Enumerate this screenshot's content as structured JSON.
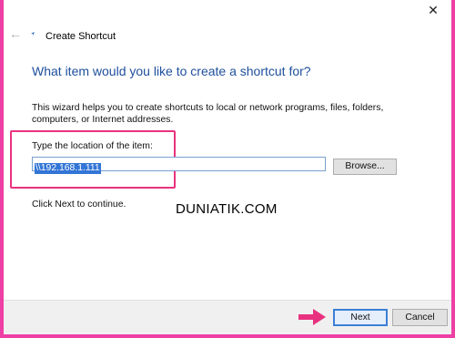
{
  "window": {
    "title": "Create Shortcut",
    "close_glyph": "✕"
  },
  "nav": {
    "back_glyph": "←"
  },
  "main": {
    "heading": "What item would you like to create a shortcut for?",
    "description": "This wizard helps you to create shortcuts to local or network programs, files, folders, computers, or Internet addresses.",
    "location_label": "Type the location of the item:",
    "location_value": "\\\\192.168.1.111",
    "browse_label": "Browse...",
    "continue_hint": "Click Next to continue."
  },
  "watermark": "DUNIATIK.COM",
  "footer": {
    "next_label": "Next",
    "cancel_label": "Cancel"
  },
  "colors": {
    "annotation": "#e8327f",
    "heading": "#1e4f9c",
    "selection": "#3375d6",
    "background": "#ee3fa4"
  },
  "icons": [
    "close-icon",
    "back-arrow-icon",
    "shortcut-app-icon",
    "pointer-arrow-icon"
  ]
}
